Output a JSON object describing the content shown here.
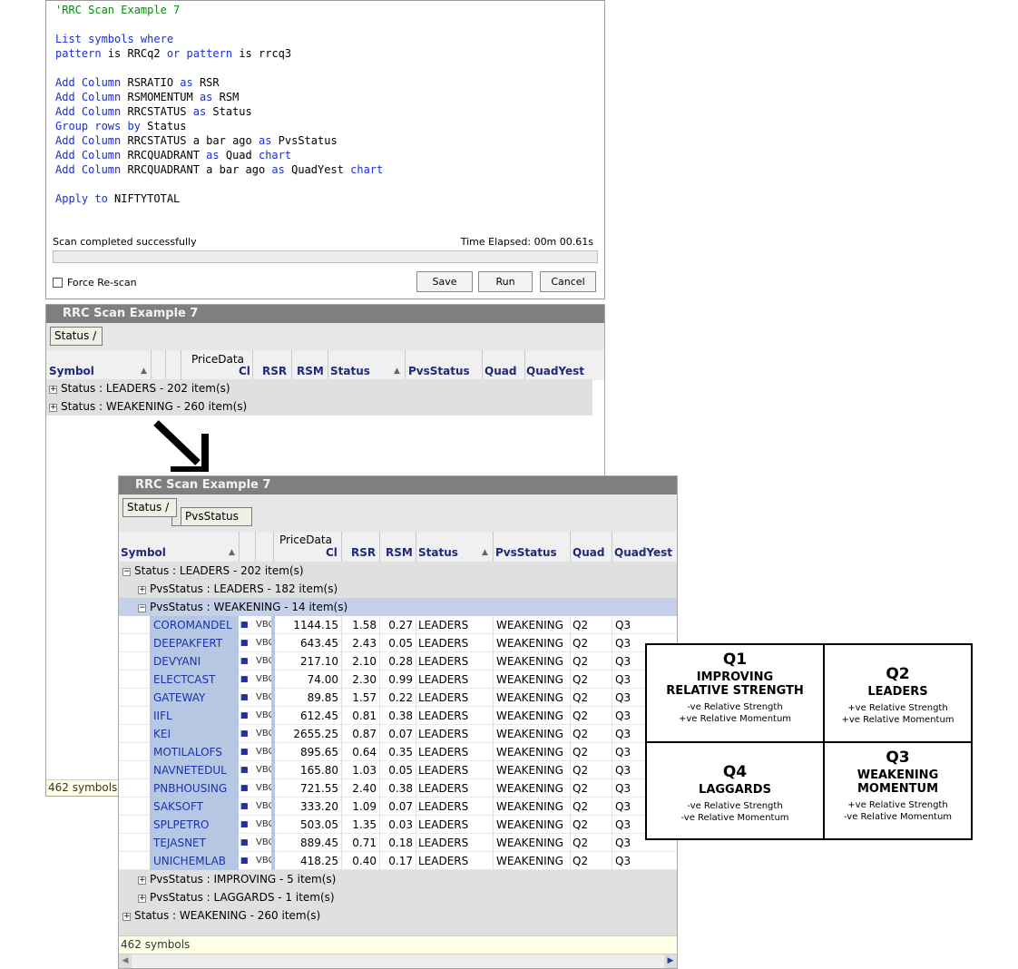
{
  "editor": {
    "code_lines": [
      [
        {
          "t": "'RRC Scan Example 7",
          "c": "cm"
        }
      ],
      [],
      [
        {
          "t": "List symbols where",
          "c": "kw"
        }
      ],
      [
        {
          "t": "pattern",
          "c": "kw"
        },
        {
          "t": " is RRCq2 "
        },
        {
          "t": "or",
          "c": "kw"
        },
        {
          "t": " "
        },
        {
          "t": "pattern",
          "c": "kw"
        },
        {
          "t": " is rrcq3"
        }
      ],
      [],
      [
        {
          "t": "Add Column",
          "c": "kw"
        },
        {
          "t": " RSRATIO "
        },
        {
          "t": "as",
          "c": "kw"
        },
        {
          "t": " RSR"
        }
      ],
      [
        {
          "t": "Add Column",
          "c": "kw"
        },
        {
          "t": " RSMOMENTUM "
        },
        {
          "t": "as",
          "c": "kw"
        },
        {
          "t": " RSM"
        }
      ],
      [
        {
          "t": "Add Column",
          "c": "kw"
        },
        {
          "t": " RRCSTATUS "
        },
        {
          "t": "as",
          "c": "kw"
        },
        {
          "t": " Status"
        }
      ],
      [
        {
          "t": "Group rows by",
          "c": "kw"
        },
        {
          "t": " Status"
        }
      ],
      [
        {
          "t": "Add Column",
          "c": "kw"
        },
        {
          "t": " RRCSTATUS a bar ago "
        },
        {
          "t": "as",
          "c": "kw"
        },
        {
          "t": " PvsStatus"
        }
      ],
      [
        {
          "t": "Add Column",
          "c": "kw"
        },
        {
          "t": " RRCQUADRANT "
        },
        {
          "t": "as",
          "c": "kw"
        },
        {
          "t": " Quad "
        },
        {
          "t": "chart",
          "c": "kw"
        }
      ],
      [
        {
          "t": "Add Column",
          "c": "kw"
        },
        {
          "t": " RRCQUADRANT a bar ago "
        },
        {
          "t": "as",
          "c": "kw"
        },
        {
          "t": " QuadYest "
        },
        {
          "t": "chart",
          "c": "kw"
        }
      ],
      [],
      [
        {
          "t": "Apply to",
          "c": "kw"
        },
        {
          "t": " NIFTYTOTAL"
        }
      ]
    ],
    "scan_message": "Scan completed successfully",
    "elapsed": "Time Elapsed: 00m 00.61s",
    "force_rescan": "Force Re-scan",
    "save": "Save",
    "run": "Run",
    "cancel": "Cancel"
  },
  "grid1": {
    "title": "RRC Scan Example 7",
    "group_chip": "Status",
    "price_data": "PriceData",
    "headers": {
      "symbol": "Symbol",
      "cl": "Cl",
      "rsr": "RSR",
      "rsm": "RSM",
      "status": "Status",
      "pvs": "PvsStatus",
      "quad": "Quad",
      "quadyest": "QuadYest"
    },
    "groups": [
      "Status : LEADERS - 202 item(s)",
      "Status : WEAKENING - 260 item(s)"
    ],
    "footer": "462 symbols"
  },
  "grid2": {
    "title": "RRC Scan Example 7",
    "group_chip": "Status",
    "group_chip2": "PvsStatus",
    "price_data": "PriceData",
    "headers": {
      "symbol": "Symbol",
      "cl": "Cl",
      "rsr": "RSR",
      "rsm": "RSM",
      "status": "Status",
      "pvs": "PvsStatus",
      "quad": "Quad",
      "quadyest": "QuadYest"
    },
    "group_leaders": "Status : LEADERS - 202 item(s)",
    "sub_leaders": "PvsStatus : LEADERS - 182 item(s)",
    "sub_weakening": "PvsStatus : WEAKENING - 14 item(s)",
    "sub_improving": "PvsStatus : IMPROVING - 5 item(s)",
    "sub_laggards": "PvsStatus : LAGGARDS - 1 item(s)",
    "group_weakening": "Status : WEAKENING - 260 item(s)",
    "chart_icon": "bar-chart-icon",
    "chart_label": "VBC",
    "rows": [
      [
        "COROMANDEL",
        "1144.15",
        "1.58",
        "0.27",
        "LEADERS",
        "WEAKENING",
        "Q2",
        "Q3"
      ],
      [
        "DEEPAKFERT",
        "643.45",
        "2.43",
        "0.05",
        "LEADERS",
        "WEAKENING",
        "Q2",
        "Q3"
      ],
      [
        "DEVYANI",
        "217.10",
        "2.10",
        "0.28",
        "LEADERS",
        "WEAKENING",
        "Q2",
        "Q3"
      ],
      [
        "ELECTCAST",
        "74.00",
        "2.30",
        "0.99",
        "LEADERS",
        "WEAKENING",
        "Q2",
        "Q3"
      ],
      [
        "GATEWAY",
        "89.85",
        "1.57",
        "0.22",
        "LEADERS",
        "WEAKENING",
        "Q2",
        "Q3"
      ],
      [
        "IIFL",
        "612.45",
        "0.81",
        "0.38",
        "LEADERS",
        "WEAKENING",
        "Q2",
        "Q3"
      ],
      [
        "KEI",
        "2655.25",
        "0.87",
        "0.07",
        "LEADERS",
        "WEAKENING",
        "Q2",
        "Q3"
      ],
      [
        "MOTILALOFS",
        "895.65",
        "0.64",
        "0.35",
        "LEADERS",
        "WEAKENING",
        "Q2",
        "Q3"
      ],
      [
        "NAVNETEDUL",
        "165.80",
        "1.03",
        "0.05",
        "LEADERS",
        "WEAKENING",
        "Q2",
        "Q3"
      ],
      [
        "PNBHOUSING",
        "721.55",
        "2.40",
        "0.38",
        "LEADERS",
        "WEAKENING",
        "Q2",
        "Q3"
      ],
      [
        "SAKSOFT",
        "333.20",
        "1.09",
        "0.07",
        "LEADERS",
        "WEAKENING",
        "Q2",
        "Q3"
      ],
      [
        "SPLPETRO",
        "503.05",
        "1.35",
        "0.03",
        "LEADERS",
        "WEAKENING",
        "Q2",
        "Q3"
      ],
      [
        "TEJASNET",
        "889.45",
        "0.71",
        "0.18",
        "LEADERS",
        "WEAKENING",
        "Q2",
        "Q3"
      ],
      [
        "UNICHEMLAB",
        "418.25",
        "0.40",
        "0.17",
        "LEADERS",
        "WEAKENING",
        "Q2",
        "Q3"
      ]
    ],
    "footer": "462 symbols"
  },
  "quadrants": {
    "q1": {
      "num": "Q1",
      "title1": "IMPROVING",
      "title2": "RELATIVE STRENGTH",
      "s1": "-ve Relative Strength",
      "s2": "+ve Relative Momentum"
    },
    "q2": {
      "num": "Q2",
      "title1": "LEADERS",
      "s1": "+ve Relative Strength",
      "s2": "+ve Relative Momentum"
    },
    "q4": {
      "num": "Q4",
      "title1": "LAGGARDS",
      "s1": "-ve Relative Strength",
      "s2": "-ve Relative Momentum"
    },
    "q3": {
      "num": "Q3",
      "title1": "WEAKENING",
      "title2": "MOMENTUM",
      "s1": "+ve Relative Strength",
      "s2": "-ve Relative Momentum"
    }
  }
}
